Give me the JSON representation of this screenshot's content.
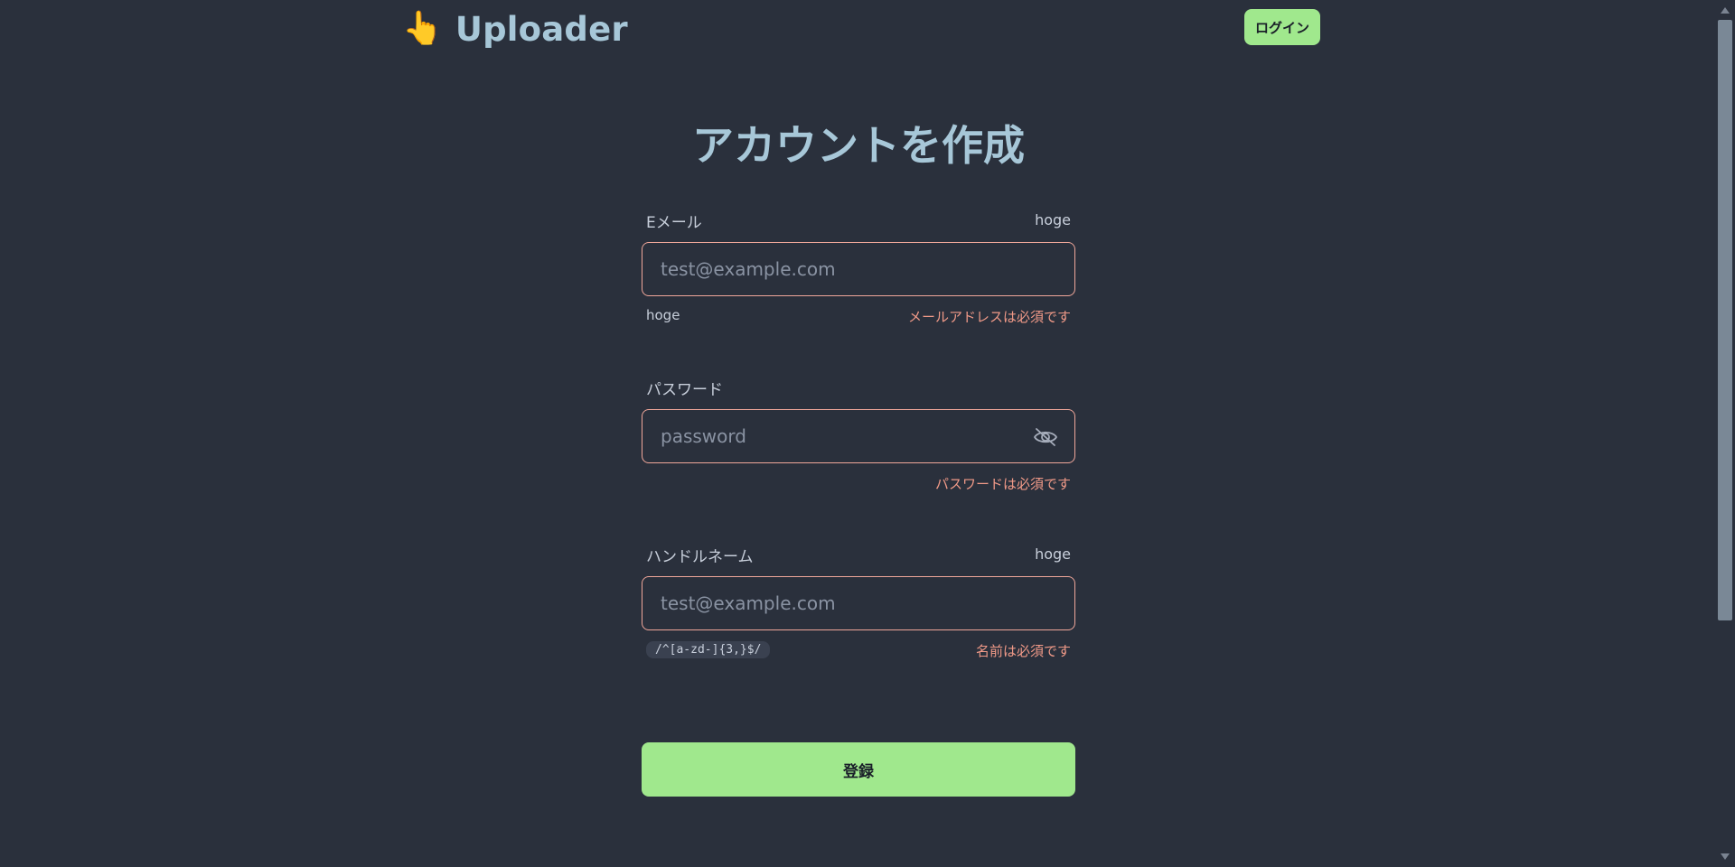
{
  "header": {
    "brand_icon": "👆",
    "brand_title": "Uploader",
    "login_label": "ログイン"
  },
  "page_title": "アカウントを作成",
  "email": {
    "label": "Eメール",
    "label_alt": "hoge",
    "placeholder": "test@example.com",
    "value": "",
    "hint": "hoge",
    "error": "メールアドレスは必須です"
  },
  "password": {
    "label": "パスワード",
    "placeholder": "password",
    "value": "",
    "visibility_icon": "eye-off-icon",
    "error": "パスワードは必須です"
  },
  "handle": {
    "label": "ハンドルネーム",
    "label_alt": "hoge",
    "placeholder": "test@example.com",
    "value": "",
    "pattern": "/^[a-zd-]{3,}$/",
    "error": "名前は必須です"
  },
  "submit_label": "登録",
  "colors": {
    "background": "#2a303c",
    "accent": "#a0e88d",
    "error": "#f19a88",
    "title": "#a7c7d8"
  }
}
